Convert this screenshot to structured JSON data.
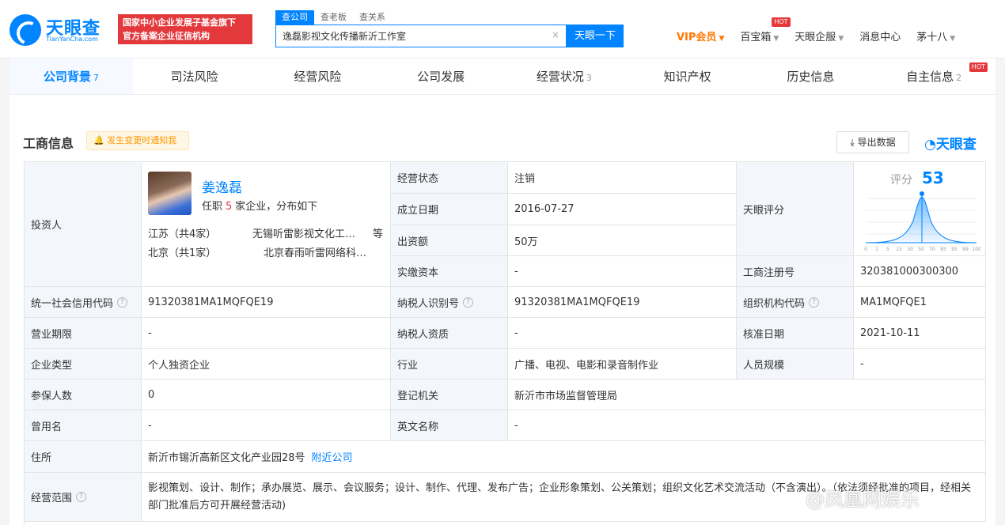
{
  "header": {
    "logo_text": "天眼查",
    "logo_sub": "TianYanCha.com",
    "gov_badge_line1": "国家中小企业发展子基金旗下",
    "gov_badge_line2": "官方备案企业征信机构",
    "search_tabs": [
      "查公司",
      "查老板",
      "查关系"
    ],
    "search_value": "逸磊影视文化传播新沂工作室",
    "search_clear": "×",
    "search_button": "天眼一下",
    "nav": {
      "vip": "VIP会员",
      "baibaoxiang": "百宝箱",
      "qiye": "天眼企服",
      "msg": "消息中心",
      "user": "茅十八"
    },
    "hot": "HOT"
  },
  "tabs": [
    {
      "label": "公司背景",
      "count": "7"
    },
    {
      "label": "司法风险",
      "count": ""
    },
    {
      "label": "经营风险",
      "count": ""
    },
    {
      "label": "公司发展",
      "count": ""
    },
    {
      "label": "经营状况",
      "count": "3"
    },
    {
      "label": "知识产权",
      "count": ""
    },
    {
      "label": "历史信息",
      "count": ""
    },
    {
      "label": "自主信息",
      "count": "2"
    }
  ],
  "section": {
    "title": "工商信息",
    "notify": "发生变更时通知我",
    "export": "导出数据",
    "watermark": "天眼查"
  },
  "investor": {
    "label": "投资人",
    "name": "姜逸磊",
    "desc_prefix": "任职",
    "desc_count": "5",
    "desc_suffix": "家企业，分布如下",
    "regions": [
      {
        "region": "江苏（共4家）",
        "company": "无锡听雷影视文化工…",
        "etc": "等"
      },
      {
        "region": "北京（共1家）",
        "company": "北京春雨听雷网络科…",
        "etc": ""
      }
    ]
  },
  "fields": {
    "status_label": "经营状态",
    "status": "注销",
    "founded_label": "成立日期",
    "founded": "2016-07-27",
    "capital_label": "出资额",
    "capital": "50万",
    "paidin_label": "实缴资本",
    "paidin": "-",
    "score_label": "天眼评分",
    "score_title": "评分",
    "score": "53",
    "regno_label": "工商注册号",
    "regno": "320381000300300",
    "credit_label": "统一社会信用代码",
    "credit": "91320381MA1MQFQE19",
    "taxid_label": "纳税人识别号",
    "taxid": "91320381MA1MQFQE19",
    "orgcode_label": "组织机构代码",
    "orgcode": "MA1MQFQE1",
    "term_label": "营业期限",
    "term": "-",
    "taxqual_label": "纳税人资质",
    "taxqual": "-",
    "approve_label": "核准日期",
    "approve": "2021-10-11",
    "type_label": "企业类型",
    "type": "个人独资企业",
    "industry_label": "行业",
    "industry": "广播、电视、电影和录音制作业",
    "staff_label": "人员规模",
    "staff": "-",
    "insured_label": "参保人数",
    "insured": "0",
    "authority_label": "登记机关",
    "authority": "新沂市市场监督管理局",
    "former_label": "曾用名",
    "former": "-",
    "english_label": "英文名称",
    "english": "-",
    "address_label": "住所",
    "address": "新沂市锡沂高新区文化产业园28号",
    "nearby": "附近公司",
    "scope_label": "经营范围",
    "scope": "影视策划、设计、制作；承办展览、展示、会议服务；设计、制作、代理、发布广告；企业形象策划、公关策划；组织文化艺术交流活动（不含演出）。（依法须经批准的项目，经相关部门批准后方可开展经营活动)"
  },
  "score_chart": {
    "ticks": [
      "0",
      "1",
      "5",
      "15",
      "30",
      "50",
      "70",
      "85",
      "95",
      "99",
      "100"
    ],
    "score_percentile": 50
  },
  "overlay_watermark": "@凤凰网娱乐"
}
